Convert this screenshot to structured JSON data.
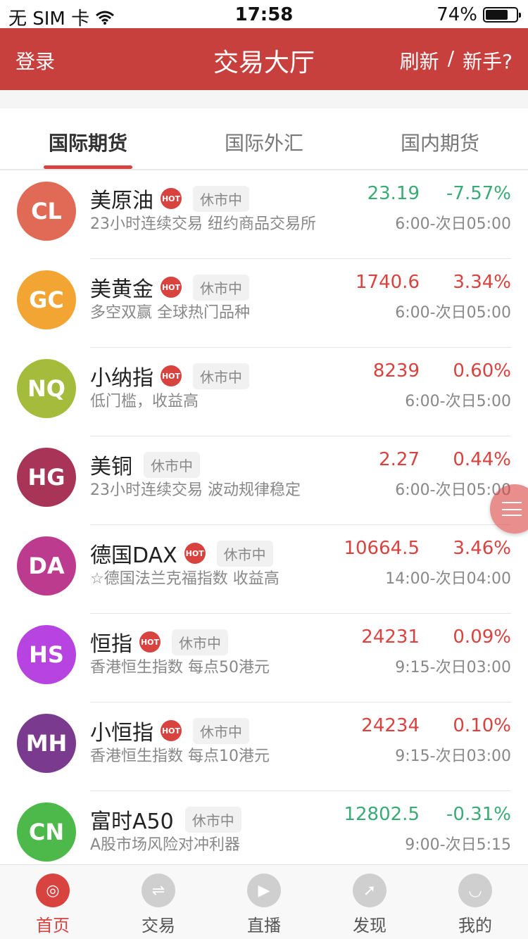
{
  "status_bar": {
    "carrier": "无 SIM 卡",
    "time": "17:58",
    "battery": "74%",
    "battery_level": 0.74
  },
  "nav": {
    "login": "登录",
    "title": "交易大厅",
    "refresh": "刷新",
    "separator": "/",
    "newbie": "新手?"
  },
  "tabs": [
    {
      "label": "国际期货",
      "active": true
    },
    {
      "label": "国际外汇",
      "active": false
    },
    {
      "label": "国内期货",
      "active": false
    }
  ],
  "items": [
    {
      "code": "CL",
      "name": "美原油",
      "hot": true,
      "status": "休市中",
      "desc": "23小时连续交易 纽约商品交易所",
      "price": "23.19",
      "change": "-7.57%",
      "hours": "6:00-次日05:00",
      "trend": "down",
      "color": "#e06a55"
    },
    {
      "code": "GC",
      "name": "美黄金",
      "hot": true,
      "status": "休市中",
      "desc": "多空双赢 全球热门品种",
      "price": "1740.6",
      "change": "3.34%",
      "hours": "6:00-次日05:00",
      "trend": "up",
      "color": "#f3a534"
    },
    {
      "code": "NQ",
      "name": "小纳指",
      "hot": true,
      "status": "休市中",
      "desc": "低门槛，收益高",
      "price": "8239",
      "change": "0.60%",
      "hours": "6:00-次日5:00",
      "trend": "up",
      "color": "#a5bb3c"
    },
    {
      "code": "HG",
      "name": "美铜",
      "hot": false,
      "status": "休市中",
      "desc": "23小时连续交易 波动规律稳定",
      "price": "2.27",
      "change": "0.44%",
      "hours": "6:00-次日05:00",
      "trend": "up",
      "color": "#a83557"
    },
    {
      "code": "DA",
      "name": "德国DAX",
      "hot": true,
      "status": "休市中",
      "desc": "☆德国法兰克福指数 收益高",
      "price": "10664.5",
      "change": "3.46%",
      "hours": "14:00-次日04:00",
      "trend": "up",
      "color": "#bd3b8f"
    },
    {
      "code": "HS",
      "name": "恒指",
      "hot": true,
      "status": "休市中",
      "desc": "香港恒生指数 每点50港元",
      "price": "24231",
      "change": "0.09%",
      "hours": "9:15-次日03:00",
      "trend": "up",
      "color": "#b743e0"
    },
    {
      "code": "MH",
      "name": "小恒指",
      "hot": true,
      "status": "休市中",
      "desc": "香港恒生指数 每点10港元",
      "price": "24234",
      "change": "0.10%",
      "hours": "9:15-次日03:00",
      "trend": "up",
      "color": "#7a3a8e"
    },
    {
      "code": "CN",
      "name": "富时A50",
      "hot": false,
      "status": "休市中",
      "desc": "A股市场风险对冲利器",
      "price": "12802.5",
      "change": "-0.31%",
      "hours": "9:00-次日5:15",
      "trend": "down",
      "color": "#4cb94a"
    }
  ],
  "hot_label": "HOT",
  "tabbar": [
    {
      "label": "首页",
      "icon": "home-icon",
      "active": true
    },
    {
      "label": "交易",
      "icon": "exchange-icon",
      "active": false
    },
    {
      "label": "直播",
      "icon": "tv-icon",
      "active": false
    },
    {
      "label": "发现",
      "icon": "compass-icon",
      "active": false
    },
    {
      "label": "我的",
      "icon": "user-icon",
      "active": false
    }
  ],
  "colors": {
    "brand_red": "#c7403d",
    "up": "#d9433f",
    "down": "#3aaa76"
  }
}
